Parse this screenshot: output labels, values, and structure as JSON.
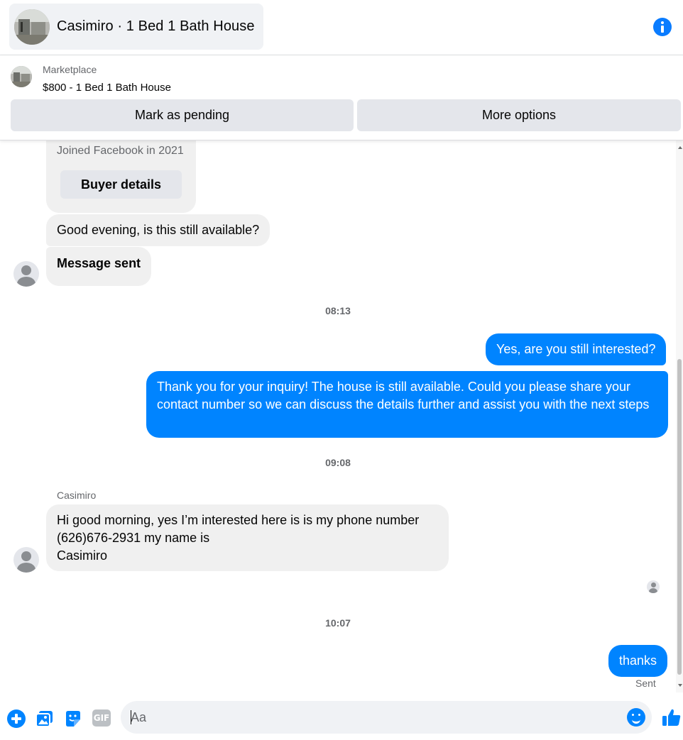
{
  "header": {
    "title": "Casimiro · 1 Bed 1 Bath House",
    "info_icon": "info-icon"
  },
  "listing": {
    "source": "Marketplace",
    "title": "$800 - 1 Bed 1 Bath House",
    "buttons": {
      "mark_pending": "Mark as pending",
      "more_options": "More options"
    }
  },
  "chat": {
    "card": {
      "joined": "Joined Facebook in 2021",
      "buyer_details": "Buyer details"
    },
    "messages": [
      {
        "from": "buyer",
        "text": "Good evening, is this still available?"
      },
      {
        "from": "buyer",
        "text": "Message sent"
      },
      {
        "type": "timestamp",
        "text": "08:13"
      },
      {
        "from": "me",
        "text": "Yes, are you still interested?"
      },
      {
        "from": "me",
        "text": "Thank you for your inquiry! The house is still available. Could you please share your contact number so we can discuss the details further and assist you with the next steps"
      },
      {
        "type": "timestamp",
        "text": "09:08"
      },
      {
        "type": "sender",
        "text": "Casimiro"
      },
      {
        "from": "buyer",
        "text": "Hi good morning, yes I’m interested here is is my phone number (626)676-2931 my name is\nCasimiro"
      },
      {
        "type": "timestamp",
        "text": "10:07"
      },
      {
        "from": "me",
        "text": "thanks"
      }
    ],
    "status": "Sent"
  },
  "composer": {
    "placeholder": "Aa",
    "icons": [
      "plus-icon",
      "photo-icon",
      "sticker-icon",
      "gif-icon",
      "emoji-icon",
      "thumbs-up-icon"
    ],
    "gif_label": "GIF"
  },
  "colors": {
    "accent": "#0084ff",
    "incoming_bubble": "#f0f0f0",
    "button_bg": "#e4e6eb",
    "secondary_text": "#65676b"
  }
}
